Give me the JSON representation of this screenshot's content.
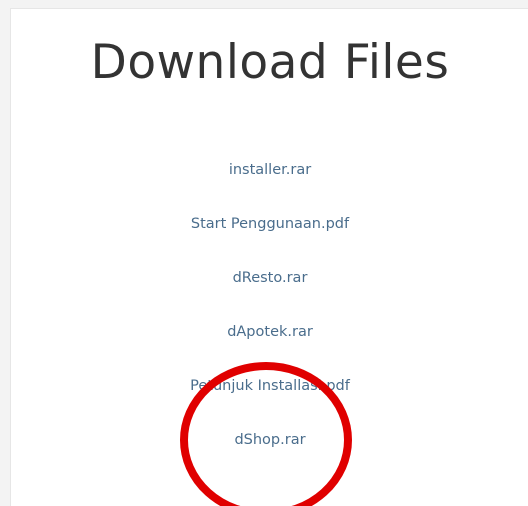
{
  "heading": "Download Files",
  "files": [
    {
      "label": "installer.rar"
    },
    {
      "label": "Start Penggunaan.pdf"
    },
    {
      "label": "dResto.rar"
    },
    {
      "label": "dApotek.rar"
    },
    {
      "label": "Petunjuk Installasi.pdf"
    },
    {
      "label": "dShop.rar"
    }
  ],
  "annotation": {
    "highlight_color": "#e00000",
    "highlighted_file_index": 5
  }
}
